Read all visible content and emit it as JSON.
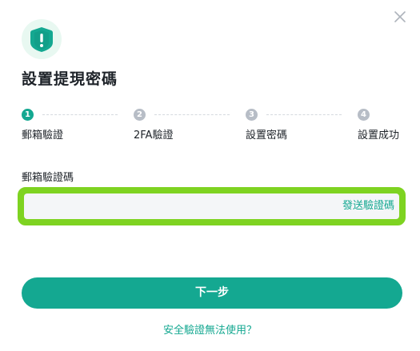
{
  "icons": {
    "close": "close-icon",
    "hero": "shield-exclamation-icon"
  },
  "colors": {
    "accent": "#14a891",
    "highlight_border": "#7ed321",
    "step_inactive": "#b7bdc6"
  },
  "dialog": {
    "title": "設置提現密碼"
  },
  "stepper": {
    "steps": [
      {
        "number": "1",
        "label": "郵箱驗證",
        "state": "active"
      },
      {
        "number": "2",
        "label": "2FA驗證",
        "state": "inactive"
      },
      {
        "number": "3",
        "label": "設置密碼",
        "state": "inactive"
      },
      {
        "number": "4",
        "label": "設置成功",
        "state": "inactive"
      }
    ]
  },
  "form": {
    "email_code_label": "郵箱驗證碼",
    "email_code_value": "",
    "send_code_label": "發送驗證碼"
  },
  "actions": {
    "next_label": "下一步",
    "help_link_label": "安全驗證無法使用？"
  }
}
